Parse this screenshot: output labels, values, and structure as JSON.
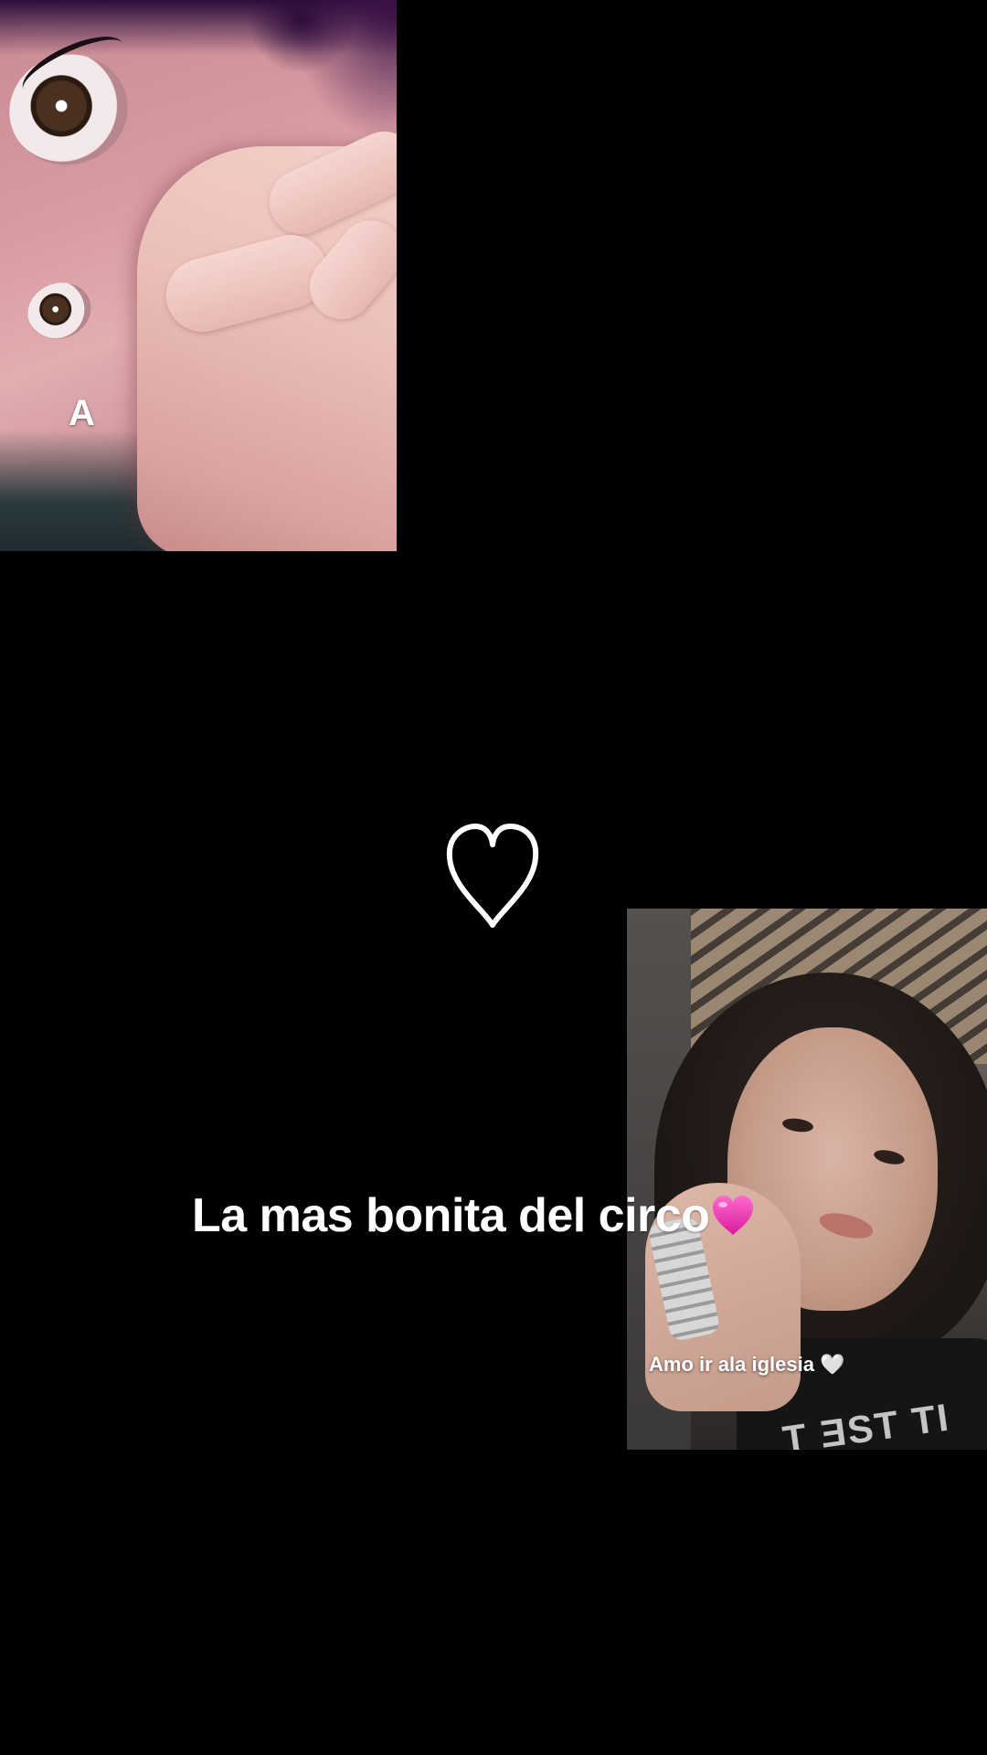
{
  "top_photo": {
    "letter": "A"
  },
  "bottom_photo": {
    "caption": "Amo ir ala iglesia 🤍",
    "shirt_text": "T ƎST TI"
  },
  "caption": {
    "text": "La mas bonita del circo",
    "emoji": "pink-heart-emoji"
  },
  "heart_icon": "heart-outline-icon",
  "colors": {
    "background": "#000000",
    "text": "#ffffff",
    "pink_heart": "#f03fb9"
  }
}
